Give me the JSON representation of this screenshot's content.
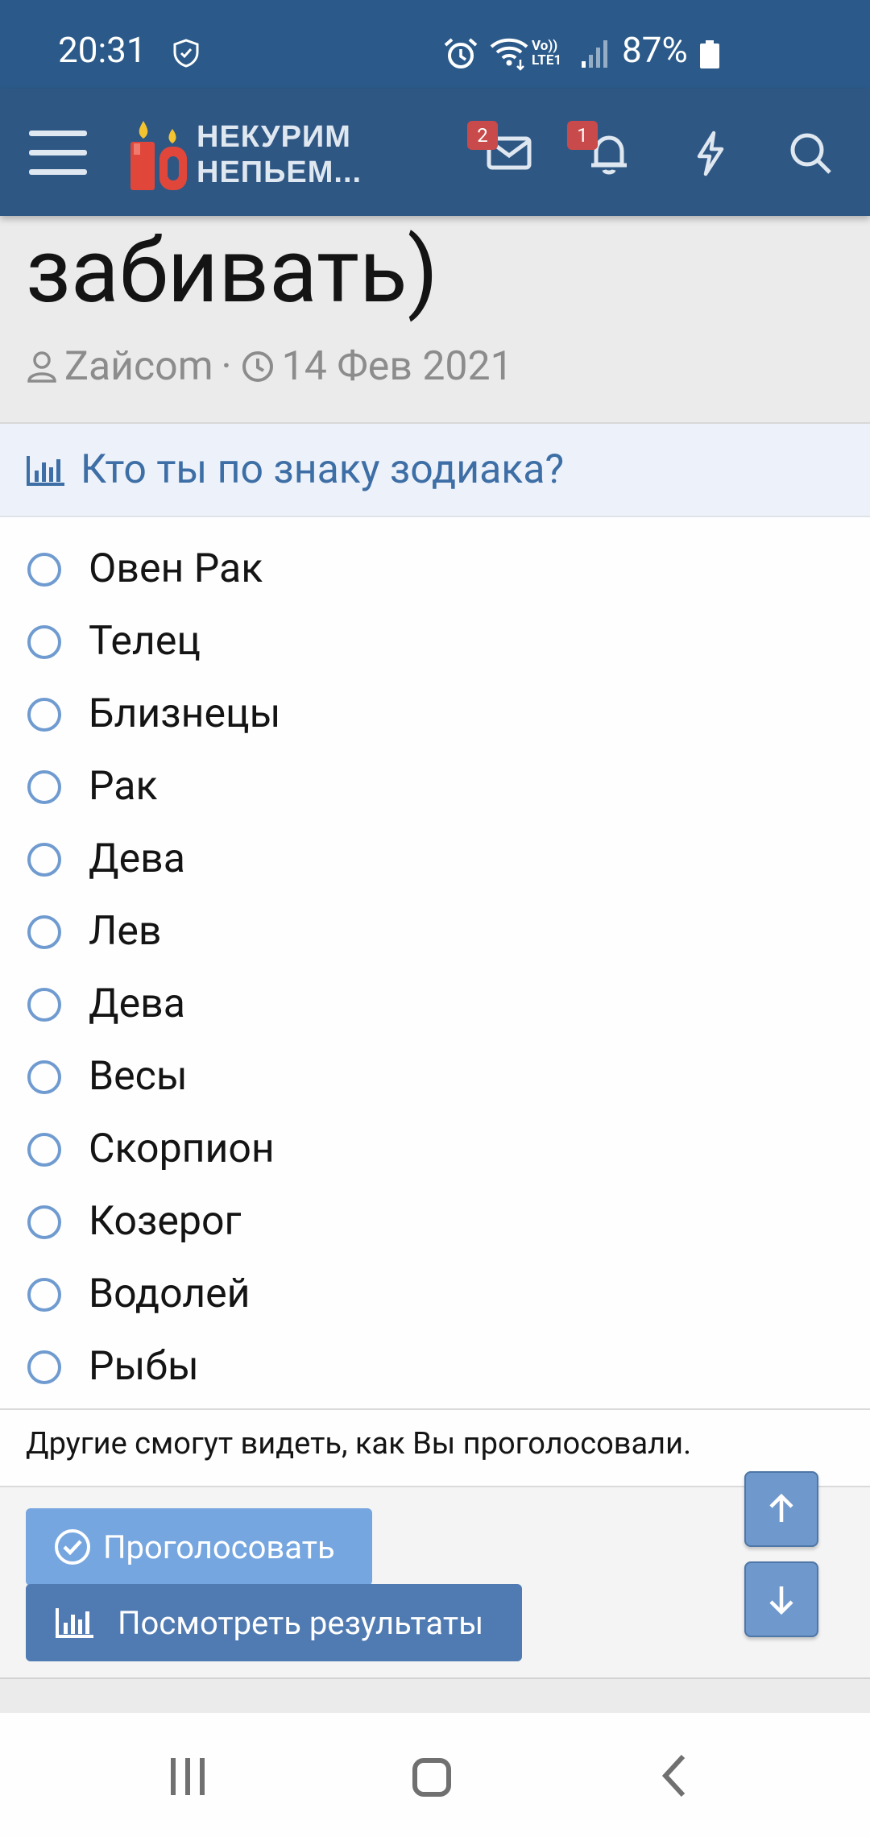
{
  "status_bar": {
    "time": "20:31",
    "lte_label": "Vo))\nLTE1",
    "battery": "87%"
  },
  "header": {
    "logo_line1": "НЕКУРИМ",
    "logo_line2": "НЕПЬЕМ...",
    "inbox_badge": "2",
    "alerts_badge": "1"
  },
  "thread": {
    "title_fragment": "забивать)",
    "author": "Zайcom",
    "separator": "·",
    "date": "14 Фев 2021"
  },
  "poll": {
    "question": "Кто ты по знаку зодиака?",
    "options": [
      "Овен Рак",
      "Телец",
      "Близнецы",
      "Рак",
      "Дева",
      "Лев",
      "Дева",
      "Весы",
      "Скорпион",
      "Козерог",
      "Водолей",
      "Рыбы"
    ],
    "notice": "Другие смогут видеть, как Вы проголосовали.",
    "vote_button": "Проголосовать",
    "results_button": "Посмотреть результаты"
  }
}
